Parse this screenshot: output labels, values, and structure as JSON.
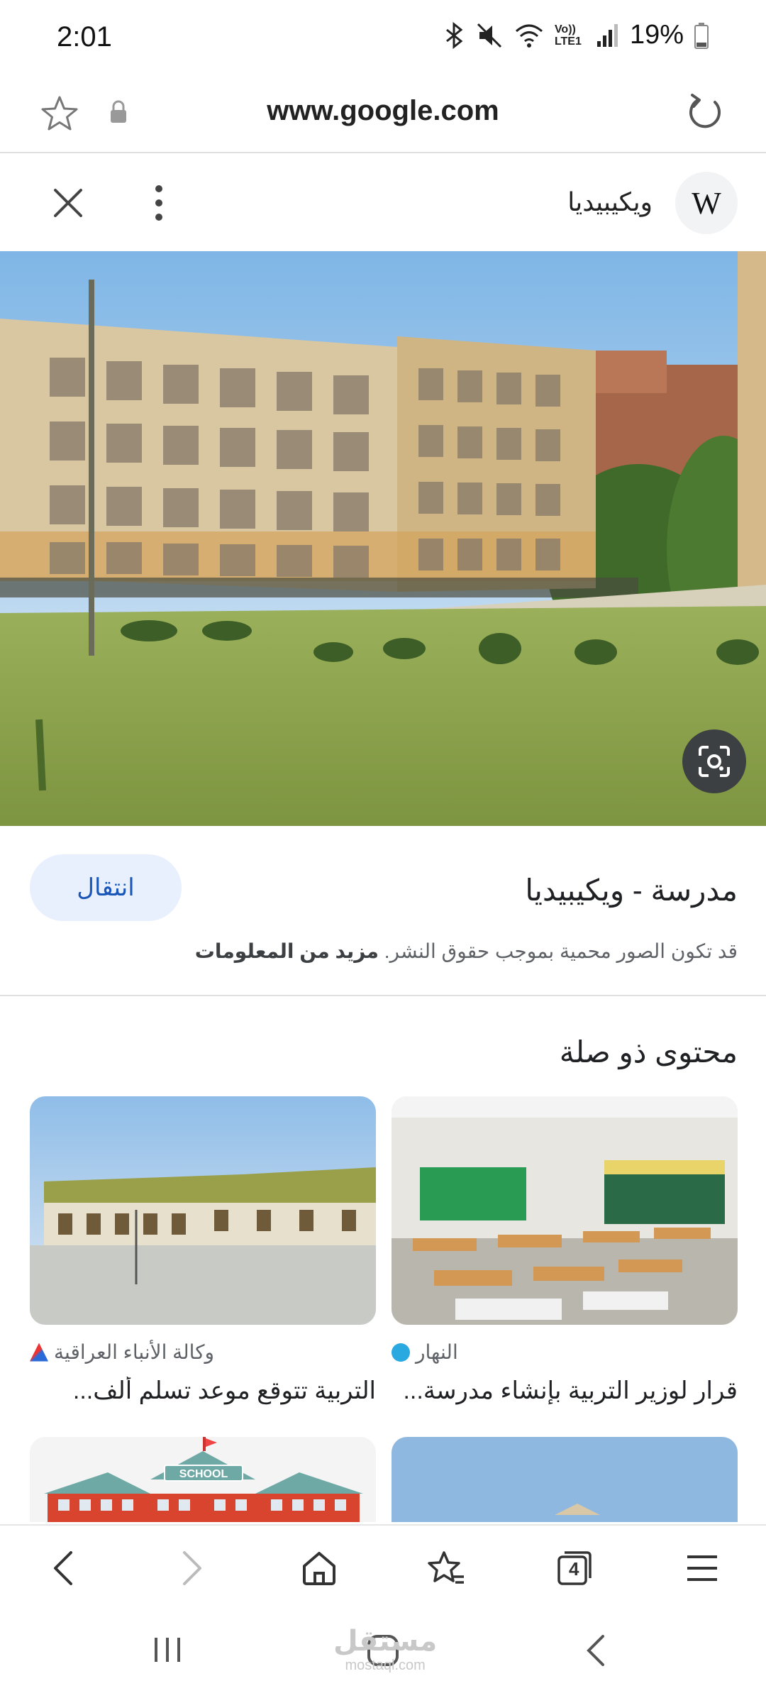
{
  "status_bar": {
    "time": "2:01",
    "network_label": "Vo)) LTE1",
    "battery": "19%"
  },
  "url_bar": {
    "url": "www.google.com"
  },
  "panel": {
    "source_name": "ويكيبيديا",
    "logo_letter": "W",
    "image_title": "مدرسة - ويكيبيديا",
    "visit_label": "انتقال",
    "copyright_text": "قد تكون الصور محمية بموجب حقوق النشر.",
    "more_info": "مزيد من المعلومات"
  },
  "related": {
    "heading": "محتوى ذو صلة",
    "cards": [
      {
        "source": "النهار",
        "title": "قرار لوزير التربية بإنشاء مدرسة..."
      },
      {
        "source": "وكالة الأنباء العراقية",
        "title": "التربية تتوقع موعد تسلم ألف..."
      },
      {
        "title": ""
      },
      {
        "title": "SCHOOL"
      }
    ]
  },
  "toolbar": {
    "tabs_count": "4"
  },
  "watermark": {
    "text": "مستقل",
    "sub": "mostaql.com"
  },
  "icons": {
    "star": "star-icon",
    "lock": "lock-icon",
    "reload": "reload-icon",
    "close": "close-icon",
    "more": "more-vert-icon",
    "lens": "lens-icon",
    "back": "back-icon",
    "forward": "forward-icon",
    "home": "home-icon",
    "bookmarks": "bookmarks-icon",
    "tabs": "tabs-icon",
    "menu": "menu-icon"
  },
  "colors": {
    "visit_button_bg": "#e8f0fe",
    "visit_button_text": "#1a56b8"
  }
}
